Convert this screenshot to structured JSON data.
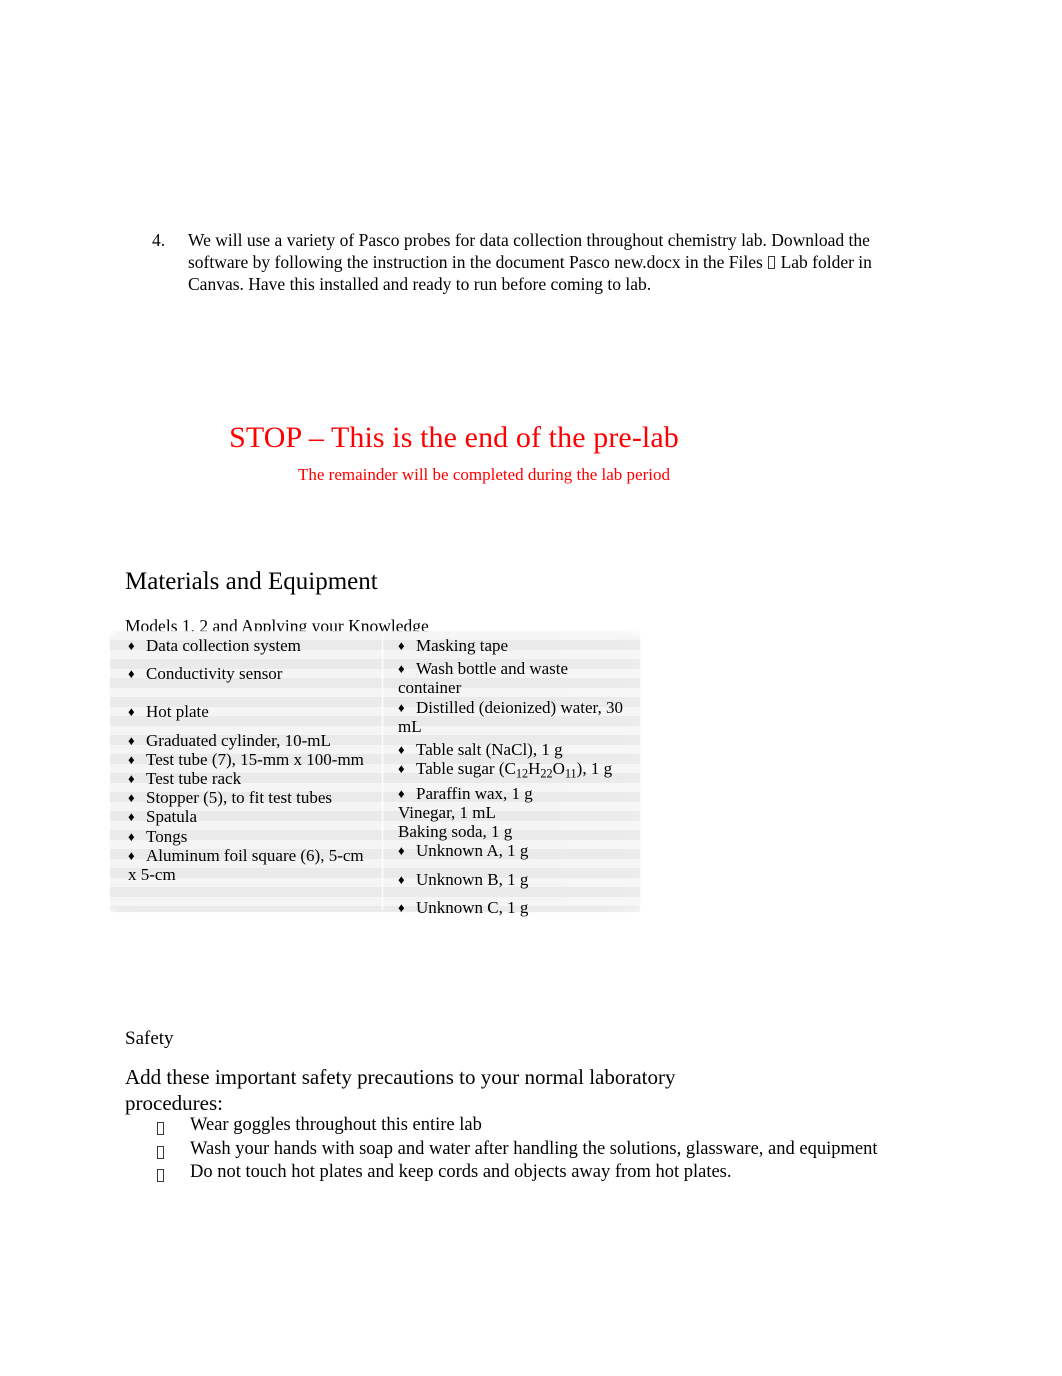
{
  "numbered_item": {
    "number": "4.",
    "text_before_glyph": "We will use a variety of Pasco probes for data collection throughout chemistry lab. Download the software by following the instruction in the document Pasco new.docx in the Files ",
    "text_after_glyph": " Lab folder in Canvas. Have this installed and ready to run before coming to lab.",
    "missing_glyph": "missing-glyph-box"
  },
  "stop_block": {
    "title": "STOP – This is the end of the pre-lab",
    "subtitle": "The remainder will be completed during the lab period",
    "color": "#ff0000"
  },
  "materials": {
    "heading": "Materials and Equipment",
    "models_line": "Models 1, 2 and Applying your Knowledge",
    "bullet_glyph": "♦",
    "left_column": [
      {
        "text": "Data collection system",
        "bullet": true,
        "gap": "none"
      },
      {
        "text": "Conductivity sensor",
        "bullet": true,
        "gap": "gap-sm"
      },
      {
        "text": "Hot plate",
        "bullet": true,
        "gap": "gap-md"
      },
      {
        "text": "Graduated cylinder, 10-mL",
        "bullet": true,
        "gap": "gap-sm"
      },
      {
        "text": "Test tube (7), 15-mm x 100-mm",
        "bullet": true,
        "gap": "none"
      },
      {
        "text": "Test tube rack",
        "bullet": true,
        "gap": "none"
      },
      {
        "text": "Stopper (5), to fit test tubes",
        "bullet": true,
        "gap": "none"
      },
      {
        "text": "Spatula",
        "bullet": true,
        "gap": "none"
      },
      {
        "text": "Tongs",
        "bullet": true,
        "gap": "none"
      },
      {
        "text": "Aluminum foil square (6), 5-cm",
        "bullet": true,
        "gap": "none"
      },
      {
        "text": "x 5-cm",
        "bullet": false,
        "gap": "none"
      }
    ],
    "right_column": [
      {
        "text": "Masking tape",
        "bullet": true,
        "gap": "none"
      },
      {
        "text": "Wash bottle and waste",
        "bullet": true,
        "gap": "gap-xs"
      },
      {
        "text": "container",
        "bullet": false,
        "gap": "none"
      },
      {
        "text": "Distilled (deionized) water, 30",
        "bullet": true,
        "gap": "none"
      },
      {
        "text": "mL",
        "bullet": false,
        "gap": "none"
      },
      {
        "text": "Table salt (NaCl), 1 g",
        "bullet": true,
        "gap": "gap-xs"
      },
      {
        "text": "Table sugar (C",
        "bullet": true,
        "gap": "none",
        "formula": {
          "sub1": "12",
          "el2": "H",
          "sub2": "22",
          "el3": "O",
          "sub3": "11",
          "suffix": "), 1 g"
        }
      },
      {
        "text": "Paraffin wax, 1 g",
        "bullet": true,
        "gap": "none"
      },
      {
        "text": "Vinegar, 1 mL",
        "bullet": false,
        "gap": "none"
      },
      {
        "text": "Baking soda, 1 g",
        "bullet": false,
        "gap": "none"
      },
      {
        "text": "Unknown A, 1 g",
        "bullet": true,
        "gap": "none"
      },
      {
        "text": "Unknown B, 1 g",
        "bullet": true,
        "gap": "gap-sm"
      },
      {
        "text": "Unknown C, 1 g",
        "bullet": true,
        "gap": "gap-sm"
      }
    ]
  },
  "safety": {
    "heading": "Safety",
    "intro": "Add these important safety precautions to your normal laboratory procedures:",
    "items": [
      "Wear goggles throughout this entire lab",
      "Wash your hands with soap and water after handling the solutions, glassware, and equipment",
      "Do not touch hot plates and keep cords and objects away from hot plates."
    ]
  }
}
